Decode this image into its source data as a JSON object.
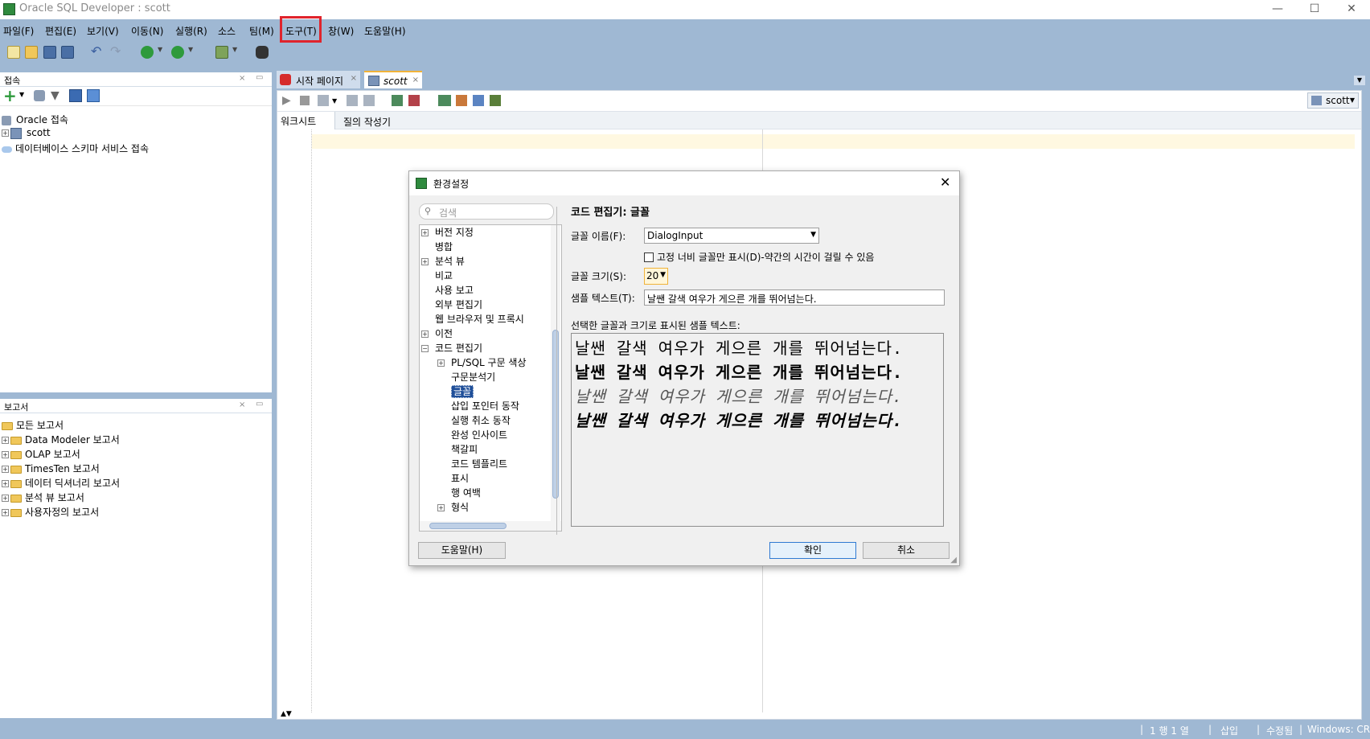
{
  "window": {
    "title": "Oracle SQL Developer : scott",
    "minimize": "—",
    "maximize": "☐",
    "close": "✕"
  },
  "menu": [
    "파일(F)",
    "편집(E)",
    "보기(V)",
    "이동(N)",
    "실행(R)",
    "소스",
    "팀(M)",
    "도구(T)",
    "창(W)",
    "도움말(H)"
  ],
  "connections_panel": {
    "title": "접속",
    "tree": [
      "Oracle 접속",
      "scott",
      "데이터베이스 스키마 서비스 접속"
    ]
  },
  "reports_panel": {
    "title": "보고서",
    "tree": [
      "모든 보고서",
      "Data Modeler 보고서",
      "OLAP 보고서",
      "TimesTen 보고서",
      "데이터 딕셔너리 보고서",
      "분석 뷰 보고서",
      "사용자정의 보고서"
    ]
  },
  "editor": {
    "tabs": [
      "시작 페이지",
      "scott"
    ],
    "subtabs": [
      "워크시트",
      "질의 작성기"
    ],
    "connection": "scott"
  },
  "dialog": {
    "title": "환경설정",
    "search_placeholder": "검색",
    "tree": [
      {
        "label": "버전 지정",
        "indent": 0,
        "expander": "+"
      },
      {
        "label": "병합",
        "indent": 0,
        "expander": ""
      },
      {
        "label": "분석 뷰",
        "indent": 0,
        "expander": "+"
      },
      {
        "label": "비교",
        "indent": 0,
        "expander": ""
      },
      {
        "label": "사용 보고",
        "indent": 0,
        "expander": ""
      },
      {
        "label": "외부 편집기",
        "indent": 0,
        "expander": ""
      },
      {
        "label": "웹 브라우저 및 프록시",
        "indent": 0,
        "expander": ""
      },
      {
        "label": "이전",
        "indent": 0,
        "expander": "+"
      },
      {
        "label": "코드 편집기",
        "indent": 0,
        "expander": "−"
      },
      {
        "label": "PL/SQL 구문 색상",
        "indent": 1,
        "expander": "+"
      },
      {
        "label": "구문분석기",
        "indent": 1,
        "expander": ""
      },
      {
        "label": "글꼴",
        "indent": 1,
        "expander": "",
        "selected": true
      },
      {
        "label": "삽입 포인터 동작",
        "indent": 1,
        "expander": ""
      },
      {
        "label": "실행 취소 동작",
        "indent": 1,
        "expander": ""
      },
      {
        "label": "완성 인사이트",
        "indent": 1,
        "expander": ""
      },
      {
        "label": "책갈피",
        "indent": 1,
        "expander": ""
      },
      {
        "label": "코드 템플리트",
        "indent": 1,
        "expander": ""
      },
      {
        "label": "표시",
        "indent": 1,
        "expander": ""
      },
      {
        "label": "행 여백",
        "indent": 1,
        "expander": ""
      },
      {
        "label": "형식",
        "indent": 1,
        "expander": "+"
      }
    ],
    "section_title": "코드 편집기: 글꼴",
    "font_name_label": "글꼴 이름(F):",
    "font_name_value": "DialogInput",
    "fixed_width_label": "고정 너비 글꼴만 표시(D)-약간의 시간이 걸릴 수 있음",
    "font_size_label": "글꼴 크기(S):",
    "font_size_value": "20",
    "sample_text_label": "샘플 텍스트(T):",
    "sample_text_value": "날쌘 갈색 여우가 게으른 개를 뛰어넘는다.",
    "preview_label": "선택한 글꼴과 크기로 표시된 샘플 텍스트:",
    "preview_lines": [
      "날쌘 갈색 여우가 게으른 개를 뛰어넘는다.",
      "날쌘 갈색 여우가 게으른 개를 뛰어넘는다.",
      "날쌘 갈색 여우가 게으른 개를 뛰어넘는다.",
      "날쌘 갈색 여우가 게으른 개를 뛰어넘는다."
    ],
    "help_button": "도움말(H)",
    "ok_button": "확인",
    "cancel_button": "취소"
  },
  "status": {
    "position": "1 행 1 열",
    "mode": "삽입",
    "modified": "수정됨",
    "line_ending": "Windows: CR"
  },
  "colors": {
    "chrome_bg": "#9fb8d3",
    "highlight_red": "#e0242c",
    "selection_blue": "#1f4f99"
  }
}
